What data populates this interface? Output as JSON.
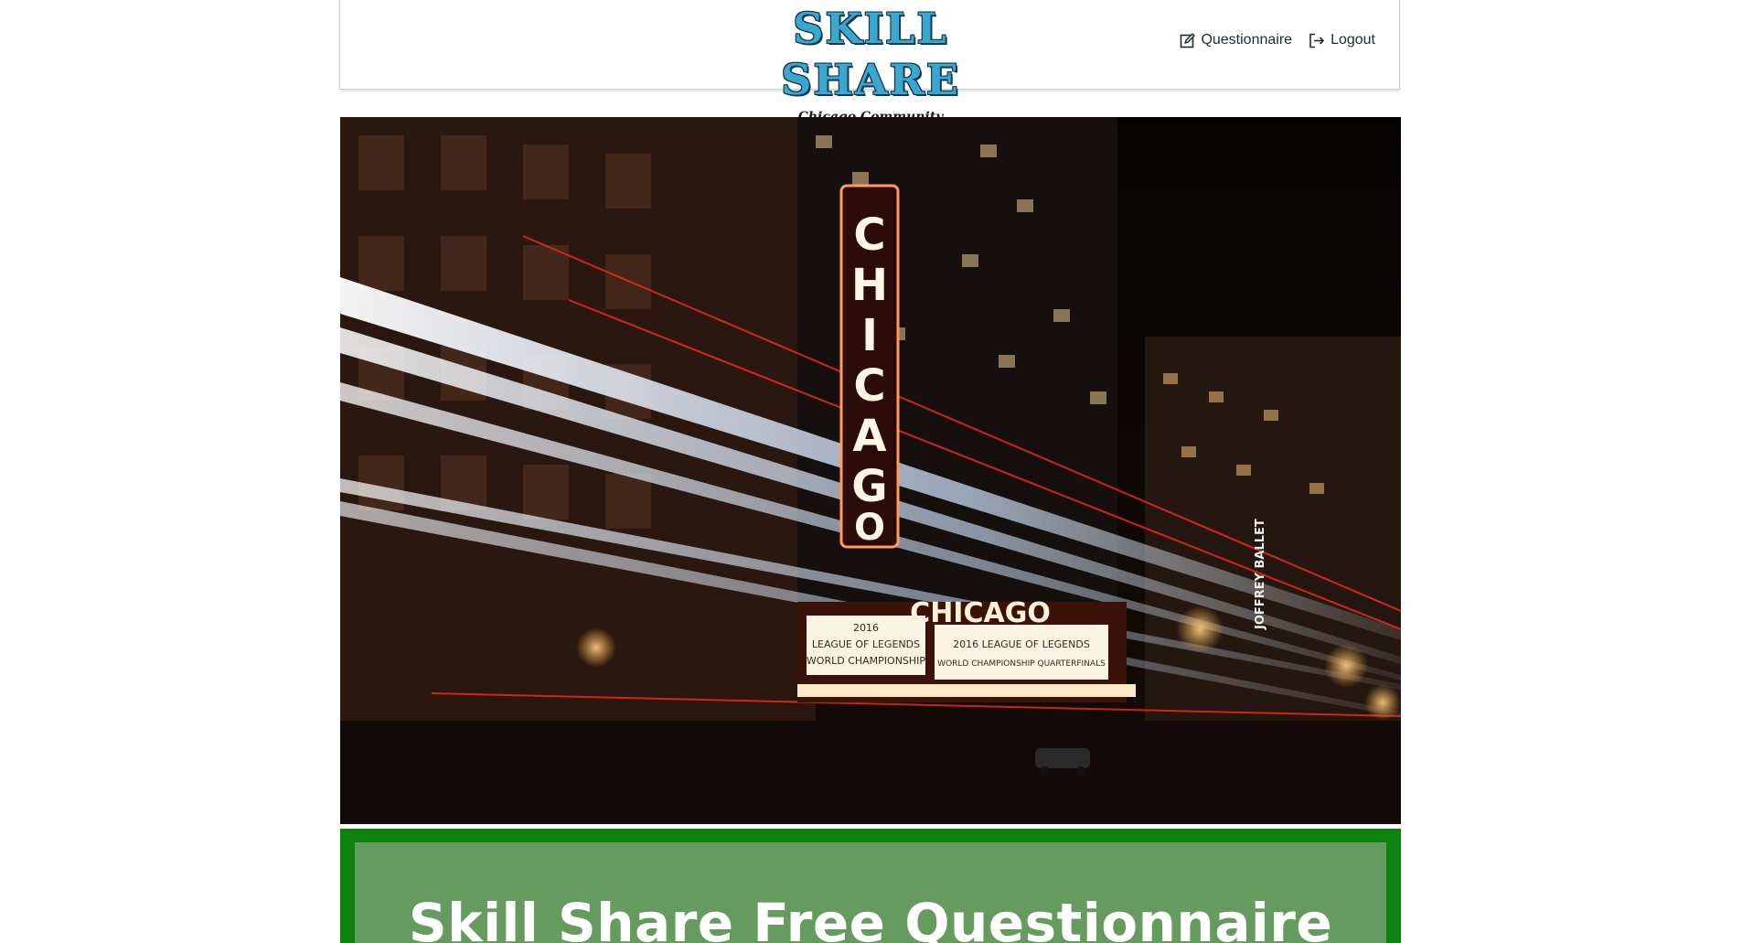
{
  "header": {
    "logo_title": "SKILL SHARE",
    "logo_subtitle": "Chicago Community",
    "nav": {
      "questionnaire_label": "Questionnaire",
      "logout_label": "Logout"
    }
  },
  "hero": {
    "image_alt": "Chicago theatre at night with light trails",
    "sign_vertical": "CHICAGO",
    "sign_marquee": "CHICAGO",
    "marquee_left": [
      "2016",
      "LEAGUE OF LEGENDS",
      "WORLD CHAMPIONSHIP"
    ],
    "marquee_right": [
      "2016 LEAGUE OF LEGENDS",
      "WORLD CHAMPIONSHIP QUARTERFINALS"
    ],
    "side_sign": "JOFFREY BALLET"
  },
  "banner": {
    "title": "Skill Share Free Questionnaire",
    "outer_color": "#0e820e",
    "inner_color": "#669b5f"
  },
  "icons": {
    "questionnaire": "edit-icon",
    "logout": "logout-icon"
  }
}
